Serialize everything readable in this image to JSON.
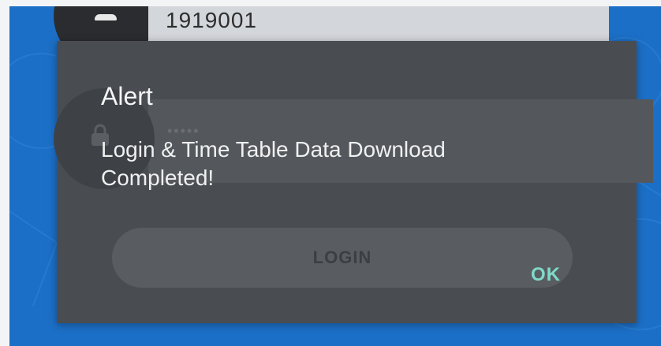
{
  "login": {
    "username_value": "1919001",
    "password_value": "•••••",
    "login_button_label": "LOGIN"
  },
  "alert": {
    "title": "Alert",
    "message": "Login & Time Table Data Download Completed!",
    "ok_label": "OK"
  },
  "colors": {
    "app_background": "#1c6fc7",
    "dialog_background": "#494d52",
    "ok_accent": "#7fd9c8"
  },
  "icons": {
    "user": "person-icon",
    "password": "lock-icon"
  }
}
